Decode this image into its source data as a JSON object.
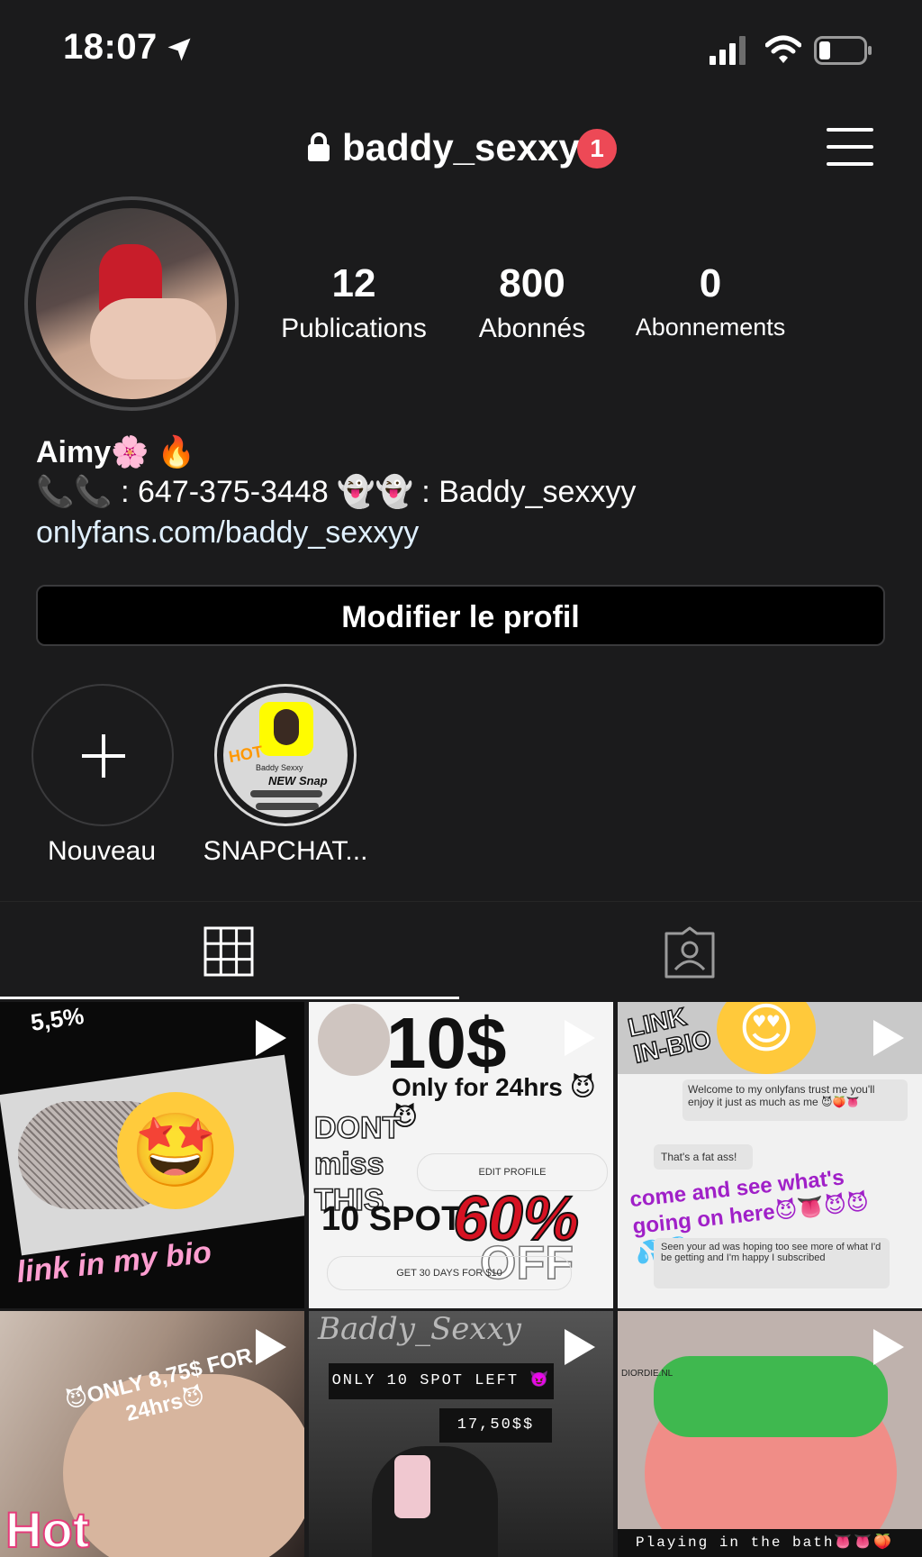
{
  "status_bar": {
    "time": "18:07"
  },
  "header": {
    "username": "baddy_sexxy",
    "notification_count": "1"
  },
  "stats": [
    {
      "value": "12",
      "label": "Publications"
    },
    {
      "value": "800",
      "label": "Abonnés"
    },
    {
      "value": "0",
      "label": "Abonnements"
    }
  ],
  "bio": {
    "name": "Aimy🌸 🔥",
    "line": "📞📞 : 647-375-3448 👻👻 : Baddy_sexxyy",
    "link": "onlyfans.com/baddy_sexxyy"
  },
  "edit_profile_label": "Modifier le profil",
  "highlights": [
    {
      "label": "Nouveau"
    },
    {
      "label": "SNAPCHAT..."
    }
  ],
  "snap_card": {
    "name": "Baddy Sexxy",
    "badge": "NEW Snap",
    "hot": "HOT"
  },
  "posts": {
    "p1": {
      "top_text": "5,5% ",
      "bottom_text": "link in my bio"
    },
    "p2": {
      "price": "10$",
      "sub": "Only for 24hrs 😈😈",
      "dont_miss": "DONT miss THIS",
      "spot": "10 SPOT",
      "discount": "60%",
      "off": "OFF",
      "edit": "EDIT PROFILE",
      "get30": "GET 30 DAYS FOR $10"
    },
    "p3": {
      "link_bio": "LINK IN-BIO",
      "msg1": "Welcome to my onlyfans trust me you'll enjoy it just as much as me 😈🍑👅",
      "msg2": "That's a fat ass!",
      "promo": "come and see what's going on here😈👅😈😈💦💦",
      "msg3": "Seen your ad was hoping too see more of what I'd be getting and I'm happy I subscribed"
    },
    "p4": {
      "text": "😈ONLY 8,75$ FOR 24hrs😈",
      "hot": "Hot"
    },
    "p5": {
      "script": "Baddy_Sexxy",
      "spots": "ONLY 10 SPOT LEFT 😈",
      "price": "17,50$$"
    },
    "p6": {
      "watermark": "DIORDIE.NL",
      "caption": "Playing in the bath👅👅🍑"
    }
  },
  "colors": {
    "background": "#1b1b1c",
    "badge": "#ed4956",
    "border": "#3a3a3c"
  }
}
